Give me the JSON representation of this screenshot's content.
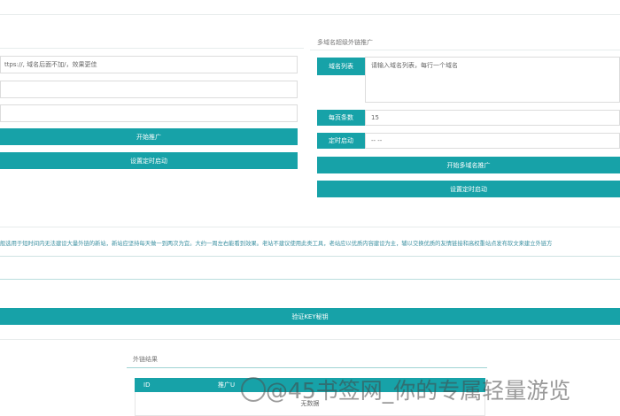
{
  "left_panel": {
    "url_input_placeholder": "ttps://, 域名后面不加/，效果更佳",
    "start_button": "开始推广",
    "schedule_button": "设置定时启动"
  },
  "right_panel": {
    "title": "多域名超级外链推广",
    "domain_list_label": "域名列表",
    "domain_list_placeholder": "请输入域名列表，每行一个域名",
    "per_page_label": "每页条数",
    "per_page_value": "15",
    "timer_label": "定时启动",
    "timer_value": "-- --",
    "start_multi_button": "开始多域名推广",
    "schedule_button": "设置定时启动"
  },
  "notice": "般选用于短时间内无法建设大量外链的新站，新站应坚持每天做一到两次为宜。大约一周左右能看到效果。老站不建议使用此类工具，老站应以优质内容建设为主，辅以交换优质的友情链接和高权重站点发布软文来建立外链方",
  "verify_button": "验证KEY秘钥",
  "results": {
    "title": "外链结果",
    "col_id": "ID",
    "col_push": "推广U",
    "empty_text": "无数据"
  },
  "watermark": "@45书签网_你的专属轻量游览"
}
